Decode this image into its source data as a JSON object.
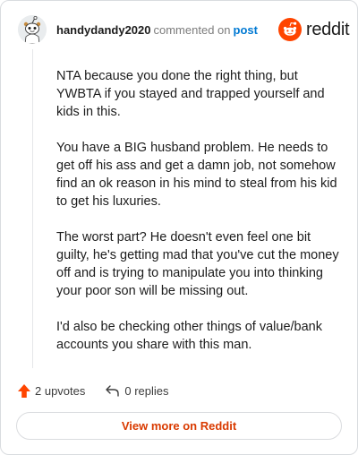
{
  "header": {
    "username": "handydandy2020",
    "action_text": "commented on",
    "post_link": "post"
  },
  "brand": {
    "wordmark": "reddit",
    "icon": "reddit-logo-icon",
    "color": "#ff4500"
  },
  "comment": {
    "paragraphs": [
      "NTA because you done the right thing, but YWBTA if you stayed and trapped yourself and kids in this.",
      "You have a BIG husband problem. He needs to get off his ass and get a damn job, not somehow find an ok reason in his mind to steal from his kid to get his luxuries.",
      "The worst part? He doesn't even feel one bit guilty, he's getting mad that you've cut the money off and is trying to manipulate you into thinking your poor son will be missing out.",
      "I'd also be checking other things of value/bank accounts you share with this man."
    ]
  },
  "actions": {
    "upvotes_label": "2 upvotes",
    "upvote_icon": "upvote-arrow-icon",
    "upvote_color": "#ff4500",
    "replies_label": "0 replies",
    "reply_icon": "reply-arrow-icon"
  },
  "footer": {
    "view_more_label": "View more on Reddit",
    "accent_color": "#d93a00"
  }
}
